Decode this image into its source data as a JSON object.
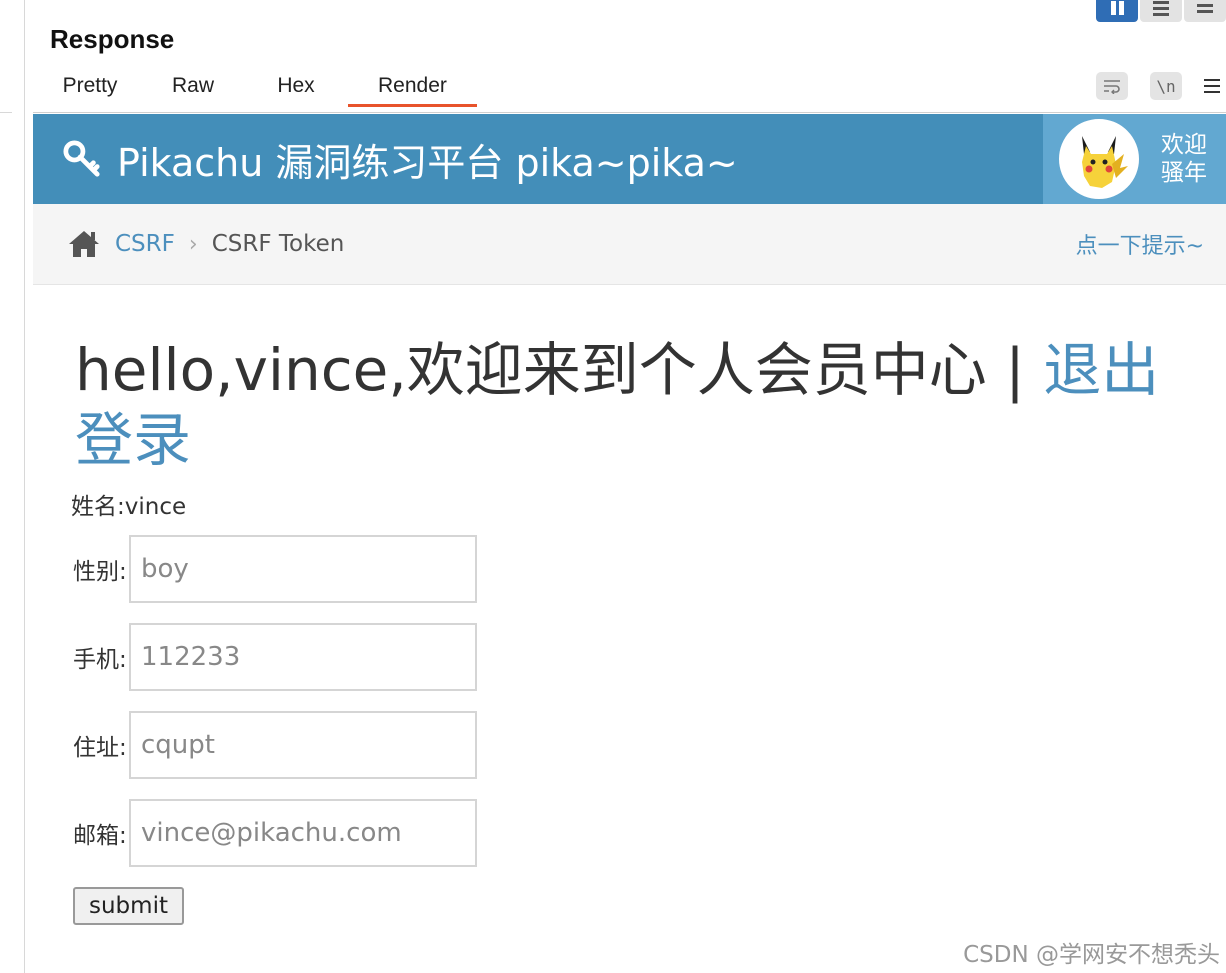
{
  "panel": {
    "title": "Response",
    "tabs": [
      "Pretty",
      "Raw",
      "Hex",
      "Render"
    ],
    "active_tab": "Render",
    "tool_newline": "\\n"
  },
  "page": {
    "brand": "Pikachu 漏洞练习平台 pika~pika~",
    "welcome_line1": "欢迎",
    "welcome_line2": "骚年",
    "breadcrumb": {
      "section": "CSRF",
      "current": "CSRF Token"
    },
    "hint": "点一下提示~",
    "headline_text": "hello,vince,欢迎来到个人会员中心 | ",
    "logout_text": "退出登录",
    "name_line": "姓名:vince",
    "fields": [
      {
        "label": "性别:",
        "placeholder": "boy"
      },
      {
        "label": "手机:",
        "placeholder": "112233"
      },
      {
        "label": "住址:",
        "placeholder": "cqupt"
      },
      {
        "label": "邮箱:",
        "placeholder": "vince@pikachu.com"
      }
    ],
    "submit_label": "submit"
  },
  "watermark": "CSDN @学网安不想秃头",
  "colors": {
    "navbar": "#438eb9",
    "user_area": "#62a8d1",
    "link": "#4c8fbd",
    "active_tab": "#e8532b"
  }
}
